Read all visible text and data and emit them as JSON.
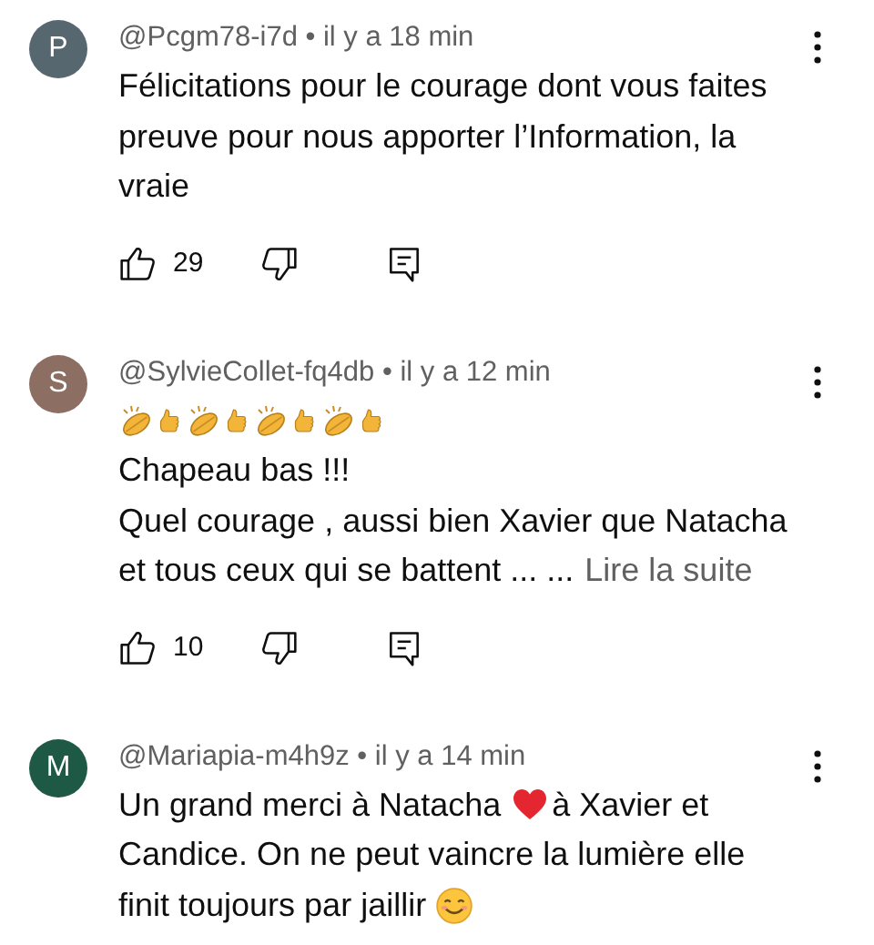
{
  "comments": [
    {
      "avatar": {
        "letter": "P",
        "color": "#56676f"
      },
      "meta": "@Pcgm78-i7d • il y a 18 min",
      "lines": [
        [
          {
            "kind": "text",
            "text": "Félicitations pour le courage dont vous faites"
          }
        ],
        [
          {
            "kind": "text",
            "text": "preuve pour nous apporter l’Information, la"
          }
        ],
        [
          {
            "kind": "text",
            "text": "vraie"
          }
        ]
      ],
      "likes": "29"
    },
    {
      "avatar": {
        "letter": "S",
        "color": "#8d6e63"
      },
      "meta": "@SylvieCollet-fq4db • il y a 12 min",
      "lines": [
        [
          {
            "kind": "clap"
          },
          {
            "kind": "thumb"
          },
          {
            "kind": "clap"
          },
          {
            "kind": "thumb"
          },
          {
            "kind": "clap"
          },
          {
            "kind": "thumb"
          },
          {
            "kind": "clap"
          },
          {
            "kind": "thumb"
          }
        ],
        [
          {
            "kind": "text",
            "text": "Chapeau bas !!!"
          }
        ],
        [
          {
            "kind": "text",
            "text": "Quel courage , aussi bien Xavier que Natacha"
          }
        ],
        [
          {
            "kind": "text",
            "text": "et tous ceux qui se battent ... ..."
          },
          {
            "kind": "link",
            "text": "Lire la suite"
          }
        ]
      ],
      "likes": "10"
    },
    {
      "avatar": {
        "letter": "M",
        "color": "#1d5945"
      },
      "meta": "@Mariapia-m4h9z • il y a 14 min",
      "lines": [
        [
          {
            "kind": "text",
            "text": "Un grand merci à Natacha"
          },
          {
            "kind": "heart"
          },
          {
            "kind": "text",
            "text": "à Xavier et"
          }
        ],
        [
          {
            "kind": "text",
            "text": "Candice. On ne peut vaincre la lumière elle"
          }
        ],
        [
          {
            "kind": "text",
            "text": "finit toujours par jaillir"
          },
          {
            "kind": "smile"
          }
        ]
      ]
    }
  ]
}
